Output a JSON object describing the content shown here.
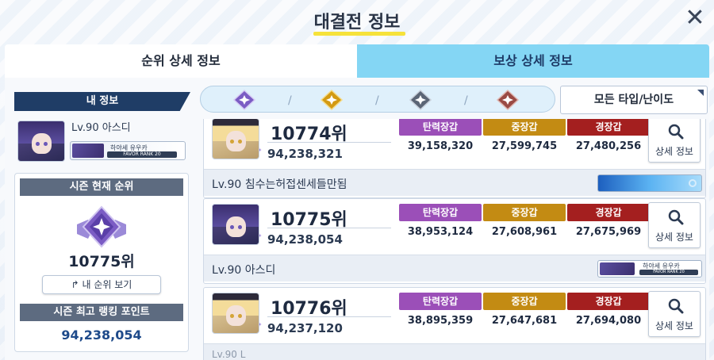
{
  "header": {
    "title": "대결전 정보",
    "close_icon": "close-icon"
  },
  "tabs": [
    {
      "label": "순위 상세 정보",
      "active": true
    },
    {
      "label": "보상 상세 정보",
      "active": false
    }
  ],
  "my_info": {
    "header": "내 정보",
    "level_name": "Lv.90 아스디",
    "nameplate_name": "하야세 유우카",
    "nameplate_rank": "FAVOR RANK 20",
    "season_current_label": "시즌 현재 순위",
    "season_rank": "10775위",
    "my_rank_button": "↱ 내 순위 보기",
    "season_best_label": "시즌 최고 랭킹 포인트",
    "season_points": "94,238,054"
  },
  "filters": {
    "emblems": [
      {
        "name": "purple-emblem-icon",
        "color": "#7b5cc4"
      },
      {
        "name": "gold-emblem-icon",
        "color": "#d39a12"
      },
      {
        "name": "gray-emblem-icon",
        "color": "#5b6575"
      },
      {
        "name": "bronze-emblem-icon",
        "color": "#9a4a44"
      }
    ],
    "separator": "/",
    "dropdown_label": "모든 타입/난이도"
  },
  "stat_labels": [
    "탄력장갑",
    "중장갑",
    "경장갑"
  ],
  "detail_label": "상세 정보",
  "entries": [
    {
      "rank": "10774위",
      "score": "94,238,321",
      "stats": [
        "39,158,320",
        "27,599,745",
        "27,480,256"
      ],
      "member": "Lv.90 침수는허접센세들만됨",
      "card": "blue",
      "avatar": "blonde"
    },
    {
      "rank": "10775위",
      "score": "94,238,054",
      "stats": [
        "38,953,124",
        "27,608,961",
        "27,675,969"
      ],
      "member": "Lv.90 아스디",
      "card_name": "하야세 유우카",
      "card_rank": "FAVOR RANK 20",
      "card": "plate",
      "avatar": "purple"
    },
    {
      "rank": "10776위",
      "score": "94,237,120",
      "stats": [
        "38,895,359",
        "27,647,681",
        "27,694,080"
      ],
      "member": "Lv.90 L",
      "card": "plate",
      "avatar": "blonde"
    }
  ],
  "colors": {
    "title_underline": "#f6e23a",
    "tab_active": "#ffffff",
    "tab_inactive": "#84d6f4",
    "header_navy": "#1f3d66",
    "stat_purple": "#9b4fb8",
    "stat_gold": "#c38b13",
    "stat_red": "#a41f1f"
  }
}
